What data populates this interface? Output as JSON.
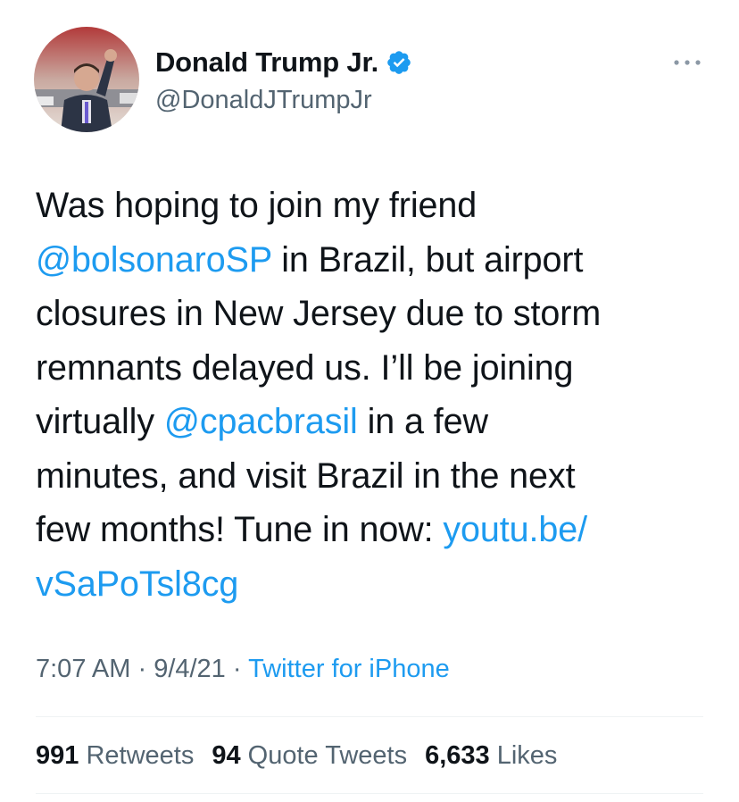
{
  "author": {
    "display_name": "Donald Trump Jr.",
    "handle": "@DonaldJTrumpJr",
    "verified": true,
    "avatar_icon": "profile-photo"
  },
  "tweet": {
    "lines": [
      [
        {
          "t": "Was hoping to join my friend",
          "link": false
        }
      ],
      [
        {
          "t": "@bolsonaroSP",
          "link": true
        },
        {
          "t": " in Brazil, but airport",
          "link": false
        }
      ],
      [
        {
          "t": "closures in New Jersey due to storm",
          "link": false
        }
      ],
      [
        {
          "t": "remnants delayed us. I’ll be joining",
          "link": false
        }
      ],
      [
        {
          "t": "virtually ",
          "link": false
        },
        {
          "t": "@cpacbrasil",
          "link": true
        },
        {
          "t": " in a few",
          "link": false
        }
      ],
      [
        {
          "t": "minutes, and visit Brazil in the next",
          "link": false
        }
      ],
      [
        {
          "t": "few months! Tune in now: ",
          "link": false
        },
        {
          "t": "youtu.be/",
          "link": true
        }
      ],
      [
        {
          "t": "vSaPoTsl8cg",
          "link": true
        }
      ]
    ]
  },
  "meta": {
    "time": "7:07 AM",
    "sep1": " · ",
    "date": "9/4/21",
    "sep2": " · ",
    "source": "Twitter for iPhone"
  },
  "stats": {
    "retweets_count": "991",
    "retweets_label": "Retweets",
    "quotes_count": "94",
    "quotes_label": "Quote Tweets",
    "likes_count": "6,633",
    "likes_label": "Likes"
  },
  "colors": {
    "link": "#1d9bf0",
    "secondary_text": "#536471",
    "primary_text": "#0f1419",
    "divider": "#eff3f4"
  }
}
